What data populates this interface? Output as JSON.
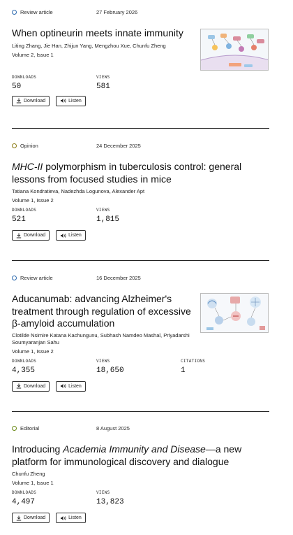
{
  "articles": [
    {
      "type": "Review article",
      "date": "27 February 2026",
      "title": "When optineurin meets innate immunity",
      "authors": "Liting Zhang, Jie Han, Zhijun Yang, Mengzhou Xue, Chunfu Zheng",
      "volume": "Volume 2, Issue 1",
      "downloads_label": "DOWNLOADS",
      "downloads": "50",
      "views_label": "VIEWS",
      "views": "581",
      "download_btn": "Download",
      "listen_btn": "Listen"
    },
    {
      "type": "Opinion",
      "date": "24 December 2025",
      "title_italic": "MHC-II",
      "title_rest": " polymorphism in tuberculosis control: general lessons from focused studies in mice",
      "authors": "Tatiana Kondratieva, Nadezhda Logunova, Alexander Apt",
      "volume": "Volume 1, Issue 2",
      "downloads_label": "DOWNLOADS",
      "downloads": "521",
      "views_label": "VIEWS",
      "views": "1,815",
      "download_btn": "Download",
      "listen_btn": "Listen"
    },
    {
      "type": "Review article",
      "date": "16 December 2025",
      "title": "Aducanumab: advancing Alzheimer's treatment through regulation of excessive β-amyloid accumulation",
      "authors": "Clotilde Nsimire Katana Kachungunu, Subhash Namdeo Mashal, Priyadarshi Soumyaranjan Sahu",
      "volume": "Volume 1, Issue 2",
      "downloads_label": "DOWNLOADS",
      "downloads": "4,355",
      "views_label": "VIEWS",
      "views": "18,650",
      "citations_label": "CITATIONS",
      "citations": "1",
      "download_btn": "Download",
      "listen_btn": "Listen"
    },
    {
      "type": "Editorial",
      "date": "8 August 2025",
      "title_pre": "Introducing ",
      "title_italic": "Academia Immunity and Disease",
      "title_post": "—a new platform for immunological discovery and dialogue",
      "authors": "Chunfu Zheng",
      "volume": "Volume 1, Issue 1",
      "downloads_label": "DOWNLOADS",
      "downloads": "4,497",
      "views_label": "VIEWS",
      "views": "13,823",
      "download_btn": "Download",
      "listen_btn": "Listen"
    }
  ],
  "colors": {
    "review": "#2e6bb0",
    "opinion": "#8a7a12",
    "editorial": "#6b8a17",
    "divider": "#222222"
  }
}
